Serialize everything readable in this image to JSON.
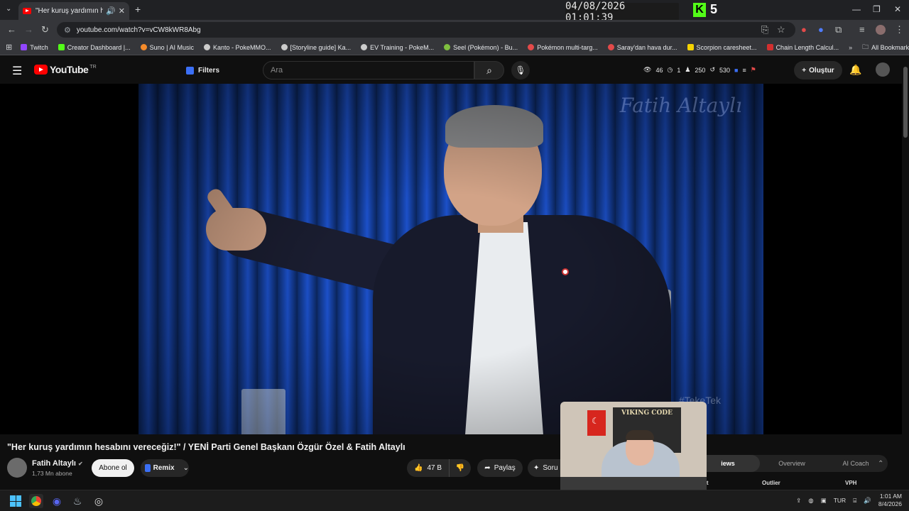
{
  "browser": {
    "tab_title": "\"Her kuruş yardımın hesab",
    "url": "youtube.com/watch?v=vCW8kWR8Abg",
    "bookmarks": [
      {
        "label": "Twitch",
        "color": "#9146ff"
      },
      {
        "label": "Creator Dashboard |...",
        "color": "#53fc18"
      },
      {
        "label": "Suno | AI Music",
        "color": "#f58b2a"
      },
      {
        "label": "Kanto - PokeMMO...",
        "color": "#cccccc"
      },
      {
        "label": "[Storyline guide] Ka...",
        "color": "#cccccc"
      },
      {
        "label": "EV Training - PokeM...",
        "color": "#cccccc"
      },
      {
        "label": "Seel (Pokémon) - Bu...",
        "color": "#7fbf3f"
      },
      {
        "label": "Pokémon multi-targ...",
        "color": "#e34a4a"
      },
      {
        "label": "Saray'dan hava dur...",
        "color": "#e34a4a"
      },
      {
        "label": "Scorpion caresheet...",
        "color": "#f5d300"
      },
      {
        "label": "Chain Length Calcul...",
        "color": "#d32f2f"
      }
    ],
    "all_bookmarks": "All Bookmarks"
  },
  "overlay": {
    "clock": "04/08/2026 01:01:39",
    "kick_count": "5"
  },
  "youtube": {
    "logo": "YouTube",
    "country": "TR",
    "filters": "Filters",
    "search_placeholder": "Ara",
    "stats": [
      "46",
      "1",
      "250",
      "530"
    ],
    "create": "Oluştur"
  },
  "video": {
    "watermark": "Fatih Altaylı",
    "corner_tag": "#TekeTek",
    "title": "\"Her kuruş yardımın hesabını vereceğiz!\" / YENİ Parti Genel Başkanı Özgür Özel & Fatih Altaylı",
    "channel": "Fatih Altaylı",
    "subscribers": "1,73 Mn abone",
    "subscribe": "Abone ol",
    "remix": "Remix",
    "likes": "47 B",
    "share": "Paylaş",
    "ask": "Soru"
  },
  "panel": {
    "tabs": [
      "iews",
      "Overview",
      "AI Coach"
    ],
    "columns": [
      "ut",
      "Outlier",
      "VPH"
    ]
  },
  "webcam": {
    "poster_text": "VIKING CODE"
  },
  "taskbar": {
    "lang": "TUR",
    "time": "1:01 AM",
    "date": "8/4/2026"
  }
}
